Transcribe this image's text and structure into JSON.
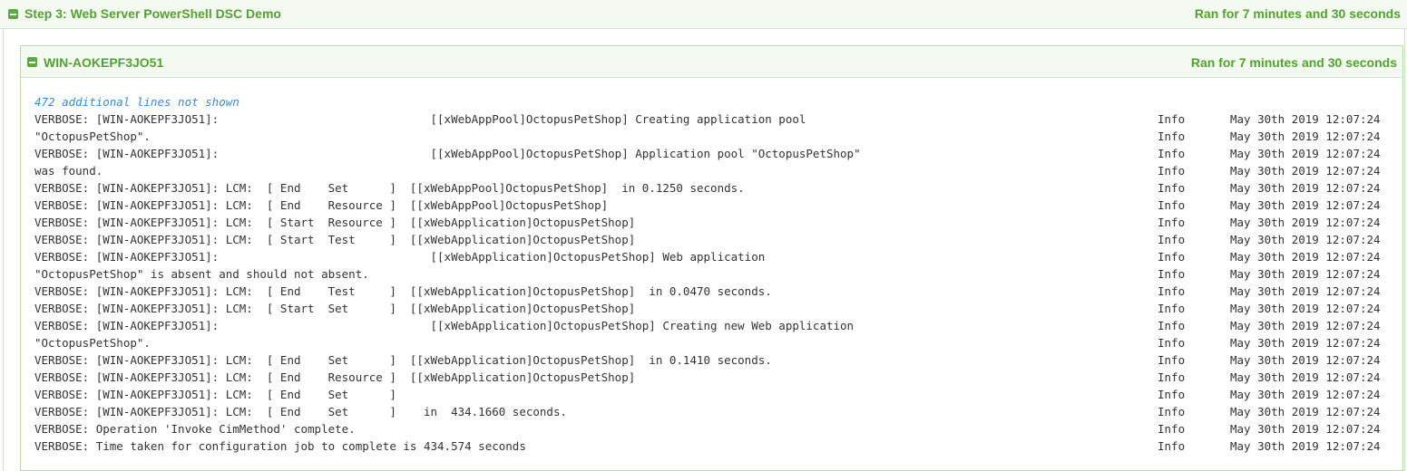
{
  "step": {
    "title": "Step 3: Web Server PowerShell DSC Demo",
    "duration": "Ran for 7 minutes and 30 seconds"
  },
  "machine": {
    "name": "WIN-AOKEPF3JO51",
    "duration": "Ran for 7 minutes and 30 seconds"
  },
  "log": {
    "hidden_lines": "472 additional lines not shown",
    "lines": [
      {
        "message": "VERBOSE: [WIN-AOKEPF3JO51]:                               [[xWebAppPool]OctopusPetShop] Creating application pool",
        "category": "Info",
        "time": "May 30th 2019 12:07:24"
      },
      {
        "message": "\"OctopusPetShop\".",
        "category": "Info",
        "time": "May 30th 2019 12:07:24"
      },
      {
        "message": "VERBOSE: [WIN-AOKEPF3JO51]:                               [[xWebAppPool]OctopusPetShop] Application pool \"OctopusPetShop\"",
        "category": "Info",
        "time": "May 30th 2019 12:07:24"
      },
      {
        "message": "was found.",
        "category": "Info",
        "time": "May 30th 2019 12:07:24"
      },
      {
        "message": "VERBOSE: [WIN-AOKEPF3JO51]: LCM:  [ End    Set      ]  [[xWebAppPool]OctopusPetShop]  in 0.1250 seconds.",
        "category": "Info",
        "time": "May 30th 2019 12:07:24"
      },
      {
        "message": "VERBOSE: [WIN-AOKEPF3JO51]: LCM:  [ End    Resource ]  [[xWebAppPool]OctopusPetShop]",
        "category": "Info",
        "time": "May 30th 2019 12:07:24"
      },
      {
        "message": "VERBOSE: [WIN-AOKEPF3JO51]: LCM:  [ Start  Resource ]  [[xWebApplication]OctopusPetShop]",
        "category": "Info",
        "time": "May 30th 2019 12:07:24"
      },
      {
        "message": "VERBOSE: [WIN-AOKEPF3JO51]: LCM:  [ Start  Test     ]  [[xWebApplication]OctopusPetShop]",
        "category": "Info",
        "time": "May 30th 2019 12:07:24"
      },
      {
        "message": "VERBOSE: [WIN-AOKEPF3JO51]:                               [[xWebApplication]OctopusPetShop] Web application",
        "category": "Info",
        "time": "May 30th 2019 12:07:24"
      },
      {
        "message": "\"OctopusPetShop\" is absent and should not absent.",
        "category": "Info",
        "time": "May 30th 2019 12:07:24"
      },
      {
        "message": "VERBOSE: [WIN-AOKEPF3JO51]: LCM:  [ End    Test     ]  [[xWebApplication]OctopusPetShop]  in 0.0470 seconds.",
        "category": "Info",
        "time": "May 30th 2019 12:07:24"
      },
      {
        "message": "VERBOSE: [WIN-AOKEPF3JO51]: LCM:  [ Start  Set      ]  [[xWebApplication]OctopusPetShop]",
        "category": "Info",
        "time": "May 30th 2019 12:07:24"
      },
      {
        "message": "VERBOSE: [WIN-AOKEPF3JO51]:                               [[xWebApplication]OctopusPetShop] Creating new Web application",
        "category": "Info",
        "time": "May 30th 2019 12:07:24"
      },
      {
        "message": "\"OctopusPetShop\".",
        "category": "Info",
        "time": "May 30th 2019 12:07:24"
      },
      {
        "message": "VERBOSE: [WIN-AOKEPF3JO51]: LCM:  [ End    Set      ]  [[xWebApplication]OctopusPetShop]  in 0.1410 seconds.",
        "category": "Info",
        "time": "May 30th 2019 12:07:24"
      },
      {
        "message": "VERBOSE: [WIN-AOKEPF3JO51]: LCM:  [ End    Resource ]  [[xWebApplication]OctopusPetShop]",
        "category": "Info",
        "time": "May 30th 2019 12:07:24"
      },
      {
        "message": "VERBOSE: [WIN-AOKEPF3JO51]: LCM:  [ End    Set      ]",
        "category": "Info",
        "time": "May 30th 2019 12:07:24"
      },
      {
        "message": "VERBOSE: [WIN-AOKEPF3JO51]: LCM:  [ End    Set      ]    in  434.1660 seconds.",
        "category": "Info",
        "time": "May 30th 2019 12:07:24"
      },
      {
        "message": "VERBOSE: Operation 'Invoke CimMethod' complete.",
        "category": "Info",
        "time": "May 30th 2019 12:07:24"
      },
      {
        "message": "VERBOSE: Time taken for configuration job to complete is 434.574 seconds",
        "category": "Info",
        "time": "May 30th 2019 12:07:24"
      }
    ]
  }
}
